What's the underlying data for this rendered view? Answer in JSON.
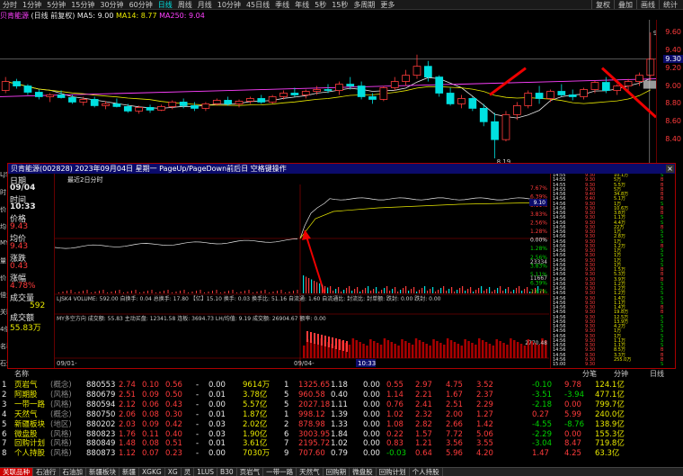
{
  "topbar": {
    "timeframes": [
      "分时",
      "1分钟",
      "5分钟",
      "15分钟",
      "30分钟",
      "60分钟",
      "日线",
      "周线",
      "月线",
      "10分钟",
      "45日线",
      "季线",
      "年线",
      "5秒",
      "15秒",
      "多周期",
      "更多"
    ],
    "active": 6,
    "tools": [
      "复权",
      "叠加",
      "画线",
      "统计"
    ]
  },
  "maline": {
    "name": "贝肯能源",
    "mode": "(日线 前复权)",
    "ma5": "MA5: 9.00",
    "ma14": "MA14: 8.77",
    "ma250": "MA250: 9.04"
  },
  "kchart": {
    "high_label": "9.60",
    "low_label": "8.19",
    "price_tag": "9.30",
    "axis": [
      "9.60",
      "9.40",
      "9.20",
      "9.00",
      "8.80",
      "8.60",
      "8.40"
    ],
    "candles": [
      [
        8.95,
        9.1,
        8.92,
        9.05
      ],
      [
        9.05,
        9.08,
        8.97,
        9.0
      ],
      [
        9.0,
        9.02,
        8.9,
        8.93
      ],
      [
        8.93,
        8.96,
        8.85,
        8.88
      ],
      [
        8.88,
        8.92,
        8.82,
        8.9
      ],
      [
        8.9,
        8.95,
        8.86,
        8.87
      ],
      [
        8.87,
        8.9,
        8.8,
        8.82
      ],
      [
        8.82,
        8.88,
        8.78,
        8.85
      ],
      [
        8.85,
        8.88,
        8.76,
        8.78
      ],
      [
        8.78,
        8.83,
        8.74,
        8.8
      ],
      [
        8.8,
        8.86,
        8.76,
        8.77
      ],
      [
        8.77,
        8.8,
        8.7,
        8.72
      ],
      [
        8.72,
        8.78,
        8.69,
        8.76
      ],
      [
        8.76,
        8.79,
        8.7,
        8.73
      ],
      [
        8.73,
        8.79,
        8.72,
        8.77
      ],
      [
        8.77,
        8.84,
        8.74,
        8.82
      ],
      [
        8.82,
        8.86,
        8.75,
        8.78
      ],
      [
        8.78,
        8.82,
        8.72,
        8.75
      ],
      [
        8.75,
        8.82,
        8.72,
        8.8
      ],
      [
        8.8,
        8.86,
        8.78,
        8.84
      ],
      [
        8.84,
        8.88,
        8.78,
        8.8
      ],
      [
        8.8,
        8.85,
        8.76,
        8.83
      ],
      [
        8.83,
        8.88,
        8.8,
        8.86
      ],
      [
        8.86,
        8.9,
        8.8,
        8.82
      ],
      [
        8.82,
        8.9,
        8.8,
        8.88
      ],
      [
        8.88,
        8.95,
        8.85,
        8.92
      ],
      [
        8.92,
        8.98,
        8.88,
        8.9
      ],
      [
        8.9,
        8.96,
        8.86,
        8.94
      ],
      [
        8.94,
        9.0,
        8.9,
        8.96
      ],
      [
        8.96,
        9.02,
        8.92,
        8.95
      ],
      [
        8.95,
        9.05,
        8.9,
        9.02
      ],
      [
        9.02,
        9.1,
        8.96,
        9.0
      ],
      [
        9.0,
        9.05,
        8.85,
        8.88
      ],
      [
        8.88,
        8.92,
        8.8,
        8.85
      ],
      [
        8.85,
        9.0,
        8.83,
        8.98
      ],
      [
        8.98,
        9.1,
        8.95,
        9.05
      ],
      [
        9.05,
        9.18,
        9.0,
        9.12
      ],
      [
        9.12,
        9.35,
        9.08,
        9.22
      ],
      [
        9.22,
        9.28,
        9.05,
        9.1
      ],
      [
        9.1,
        9.12,
        8.88,
        8.92
      ],
      [
        8.92,
        8.98,
        8.78,
        8.8
      ],
      [
        8.8,
        8.9,
        8.75,
        8.86
      ],
      [
        8.86,
        8.88,
        8.72,
        8.75
      ],
      [
        8.75,
        8.8,
        8.55,
        8.6
      ],
      [
        8.6,
        8.7,
        8.19,
        8.4
      ],
      [
        8.4,
        8.72,
        8.38,
        8.68
      ],
      [
        8.68,
        8.82,
        8.62,
        8.78
      ],
      [
        8.78,
        8.95,
        8.75,
        8.92
      ],
      [
        8.92,
        9.0,
        8.8,
        8.86
      ],
      [
        8.86,
        8.96,
        8.82,
        8.94
      ],
      [
        8.94,
        9.02,
        8.88,
        8.9
      ],
      [
        8.9,
        8.96,
        8.84,
        8.88
      ],
      [
        8.88,
        8.98,
        8.85,
        8.96
      ],
      [
        8.96,
        9.06,
        8.92,
        9.04
      ],
      [
        9.04,
        9.1,
        8.92,
        8.95
      ],
      [
        8.95,
        9.02,
        8.9,
        9.0
      ],
      [
        9.0,
        9.08,
        8.95,
        9.05
      ],
      [
        9.05,
        9.15,
        9.0,
        9.12
      ],
      [
        9.12,
        9.6,
        9.05,
        9.3
      ]
    ]
  },
  "popup": {
    "title": "贝肯能源(002828) 2023年09月04日 星期一 PageUp/PageDown前后日 空格键操作",
    "subtitle": "最近2日分时",
    "close": "×",
    "date": "09/04",
    "time": "10:33",
    "price_lbl": "价格",
    "price": "9.43",
    "avg_lbl": "均价",
    "avg": "9.43",
    "chg_lbl": "涨跌",
    "chg": "0.43",
    "pct_lbl": "涨幅",
    "pct": "4.78%",
    "vol_lbl": "成交量",
    "vol": "592",
    "amt_lbl": "成交额",
    "amt": "55.83万",
    "pct_axis": [
      "7.67%",
      "6.39%",
      "5.11%",
      "3.83%",
      "2.56%",
      "1.28%",
      "0.00%",
      "1.28%",
      "2.56%",
      "3.83%",
      "5.11%",
      "6.39%",
      "7.67%"
    ],
    "price_tag": "9.10",
    "vol_axis": "23334",
    "vol_axis2": "11667",
    "indicator1": "LJSK4 VOLUME: 592.00 自换手: 0.04 总换手: 17.80 【亿】15.10 换手: 0.03 换手比: 51.16 自流通: 1.60 自流通比: 封流比: 封单额: 跌封: 0.00 跌封: 0.00",
    "indicator2": "MY多空方向 成交额: 55.83 主动买盘: 12341.58 连板: 3694.73 LH/均值: 9.19 成交额: 26904.67 额率: 0.00",
    "x_start": "09/01-",
    "x_mid": "09/04-",
    "x_cursor": "10:33",
    "amt_axis": "2770.48"
  },
  "ticks": [
    [
      "14:55",
      "9.30",
      "10.1万",
      "S"
    ],
    [
      "14:55",
      "9.30",
      "5万",
      "B"
    ],
    [
      "14:55",
      "9.30",
      "5.5万",
      "B"
    ],
    [
      "14:55",
      "9.30",
      "5万",
      "B"
    ],
    [
      "14:56",
      "9.40",
      "34.8万",
      "B"
    ],
    [
      "14:56",
      "9.40",
      "5.1万",
      "B"
    ],
    [
      "14:56",
      "9.30",
      "1万",
      "S"
    ],
    [
      "14:56",
      "9.30",
      "10.6万",
      "B"
    ],
    [
      "14:56",
      "9.30",
      "3.8万",
      "B"
    ],
    [
      "14:56",
      "9.30",
      "1.1万",
      "S"
    ],
    [
      "14:56",
      "9.30",
      "4.4万",
      "S"
    ],
    [
      "14:56",
      "9.30",
      "22万",
      "B"
    ],
    [
      "14:56",
      "9.30",
      "1万",
      "S"
    ],
    [
      "14:56",
      "9.30",
      "2.8万",
      "S"
    ],
    [
      "14:56",
      "9.30",
      "1万",
      "S"
    ],
    [
      "14:56",
      "9.30",
      "1.2万",
      "B"
    ],
    [
      "14:56",
      "9.30",
      "1万",
      "S"
    ],
    [
      "14:56",
      "9.30",
      "1万",
      "S"
    ],
    [
      "14:56",
      "9.30",
      "1万",
      "S"
    ],
    [
      "14:56",
      "9.30",
      "1万",
      "S"
    ],
    [
      "14:56",
      "9.30",
      "1.5万",
      "B"
    ],
    [
      "14:56",
      "9.30",
      "5.3万",
      "B"
    ],
    [
      "14:56",
      "9.30",
      "3.9万",
      "B"
    ],
    [
      "14:56",
      "9.30",
      "1.2万",
      "S"
    ],
    [
      "14:56",
      "9.30",
      "1.2万",
      "S"
    ],
    [
      "14:56",
      "9.30",
      "1.2万",
      "S"
    ],
    [
      "14:56",
      "9.30",
      "1.4万",
      "S"
    ],
    [
      "14:56",
      "9.30",
      "1.1万",
      "S"
    ],
    [
      "14:56",
      "9.30",
      "1.4万",
      "B"
    ],
    [
      "14:56",
      "9.30",
      "19.8万",
      "B"
    ],
    [
      "14:56",
      "9.30",
      "12.5万",
      "S"
    ],
    [
      "14:56",
      "9.30",
      "13.9万",
      "S"
    ],
    [
      "14:56",
      "9.30",
      "4.2万",
      "S"
    ],
    [
      "14:56",
      "9.30",
      "1万",
      "S"
    ],
    [
      "14:56",
      "9.30",
      "1万",
      "S"
    ],
    [
      "14:56",
      "9.30",
      "1.1万",
      "S"
    ],
    [
      "14:56",
      "9.30",
      "1.1万",
      "S"
    ],
    [
      "14:56",
      "9.30",
      "8.5万",
      "B"
    ],
    [
      "14:56",
      "9.30",
      "3.3万",
      "B"
    ],
    [
      "14:56",
      "9.30",
      "255.0万",
      "B"
    ],
    [
      "15:00",
      "9.30",
      "",
      "S"
    ]
  ],
  "left": {
    "labels": [
      "LJSK4 VO",
      "时",
      "价",
      "均",
      "MYZF1 VO",
      "量",
      "价",
      "倍量柱 VO",
      "关联个",
      "4倍.4",
      "名称 ↑",
      "石油"
    ]
  },
  "table": {
    "headers": [
      "名称",
      "",
      "",
      "",
      "",
      "",
      "",
      "",
      "",
      "",
      "",
      "",
      "",
      "",
      "",
      "",
      "",
      "",
      "分笔",
      "分钟",
      "日线"
    ],
    "rows": [
      [
        "1",
        "页岩气",
        "(概念)",
        "880553",
        "2.74",
        "0.10",
        "0.56",
        "-",
        "0.00",
        "9614万",
        "1",
        "1325.65",
        "1.18",
        "0.00",
        "0.55",
        "2.97",
        "4.75",
        "3.52",
        "-0.10",
        "9.78",
        "124.1亿"
      ],
      [
        "2",
        "阿期股",
        "(风格)",
        "880679",
        "2.51",
        "0.09",
        "0.50",
        "-",
        "0.01",
        "3.78亿",
        "5",
        "960.58",
        "0.40",
        "0.00",
        "1.14",
        "2.21",
        "1.67",
        "2.37",
        "-3.51",
        "-3.94",
        "477.1亿"
      ],
      [
        "3",
        "一带一路",
        "(风格)",
        "880594",
        "2.12",
        "0.06",
        "0.43",
        "-",
        "0.00",
        "5.57亿",
        "5",
        "2027.18",
        "1.11",
        "0.00",
        "0.76",
        "2.41",
        "2.51",
        "2.29",
        "-2.18",
        "0.00",
        "799.7亿"
      ],
      [
        "4",
        "天然气",
        "(概念)",
        "880750",
        "2.06",
        "0.08",
        "0.30",
        "-",
        "0.01",
        "1.87亿",
        "1",
        "998.12",
        "1.39",
        "0.00",
        "1.02",
        "2.32",
        "2.00",
        "1.27",
        "0.27",
        "5.99",
        "240.0亿"
      ],
      [
        "5",
        "新疆板块",
        "(地区)",
        "880202",
        "2.03",
        "0.09",
        "0.42",
        "-",
        "0.03",
        "2.02亿",
        "2",
        "878.98",
        "1.33",
        "0.00",
        "1.08",
        "2.82",
        "2.66",
        "1.42",
        "-4.55",
        "-8.76",
        "138.9亿"
      ],
      [
        "6",
        "微盘股",
        "(风格)",
        "880823",
        "1.76",
        "0.11",
        "0.40",
        "-",
        "0.03",
        "1.90亿",
        "6",
        "3003.95",
        "1.84",
        "0.00",
        "0.22",
        "1.57",
        "7.72",
        "5.06",
        "-2.29",
        "0.00",
        "155.3亿"
      ],
      [
        "7",
        "回购计划",
        "(风格)",
        "880849",
        "1.48",
        "0.08",
        "0.51",
        "-",
        "0.01",
        "3.61亿",
        "7",
        "2195.72",
        "1.02",
        "0.00",
        "0.83",
        "1.21",
        "3.56",
        "3.55",
        "-3.04",
        "8.47",
        "719.8亿"
      ],
      [
        "8",
        "个人持股",
        "(风格)",
        "880873",
        "1.12",
        "0.07",
        "0.23",
        "-",
        "0.00",
        "7030万",
        "9",
        "707.60",
        "0.79",
        "0.00",
        "-0.03",
        "0.64",
        "5.96",
        "4.20",
        "1.47",
        "4.25",
        "63.3亿"
      ]
    ]
  },
  "botbar": [
    "关联品种",
    "石油行",
    "石油加",
    "新疆板块",
    "新疆",
    "XGKG",
    "XG",
    "灵",
    "1LUS",
    "B30",
    "页岩气",
    "一带一路",
    "天然气",
    "回购期",
    "微盘股",
    "回购计划",
    "个人持股"
  ],
  "colors": {
    "up": "#ff3b3b",
    "down": "#00e0e0",
    "bg": "#000000",
    "accent": "#a00000"
  }
}
